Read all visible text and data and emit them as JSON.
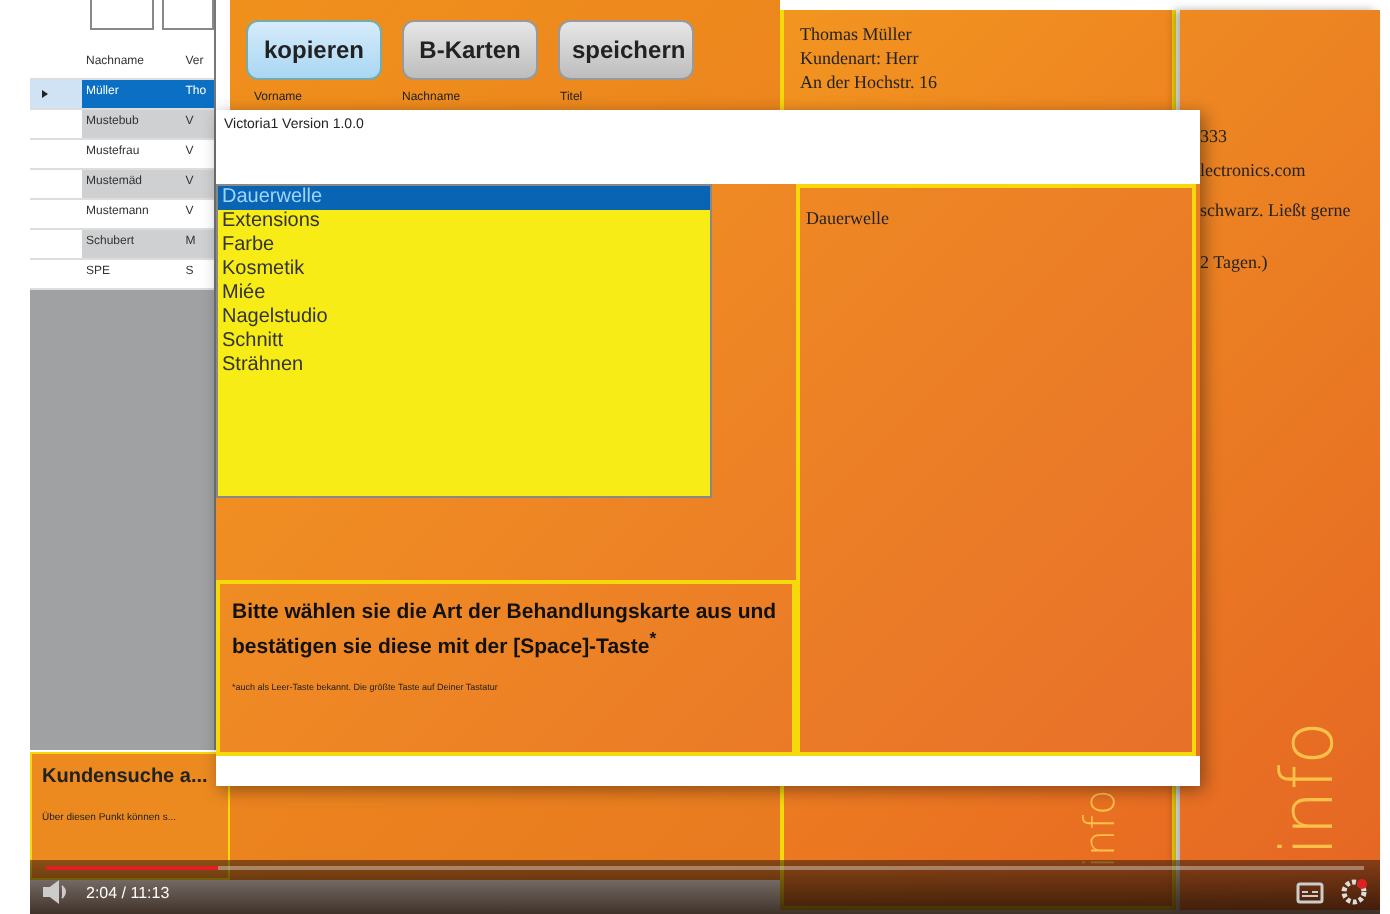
{
  "grid": {
    "columns": [
      "Nachname",
      "Ver"
    ],
    "rows": [
      {
        "cells": [
          "Müller",
          "Tho"
        ],
        "selected": true
      },
      {
        "cells": [
          "Mustebub",
          "V"
        ],
        "selected": false
      },
      {
        "cells": [
          "Mustefrau",
          "V"
        ],
        "selected": false
      },
      {
        "cells": [
          "Mustemäd",
          "V"
        ],
        "selected": false
      },
      {
        "cells": [
          "Mustemann",
          "V"
        ],
        "selected": false
      },
      {
        "cells": [
          "Schubert",
          "M"
        ],
        "selected": false
      },
      {
        "cells": [
          "SPE",
          "S"
        ],
        "selected": false
      }
    ]
  },
  "toolbar": {
    "buttons": [
      {
        "label": "kopieren",
        "selected": true
      },
      {
        "label": "B-Karten",
        "selected": false
      },
      {
        "label": "speichern",
        "selected": false
      }
    ]
  },
  "form_labels": [
    "Vorname",
    "Nachname",
    "Titel"
  ],
  "customer_card": {
    "lines": [
      "Thomas Müller",
      "Kundenart: Herr",
      "An der Hochstr. 16"
    ]
  },
  "details_fragments": [
    "333",
    "lectronics.com",
    "schwarz. Ließt gerne",
    "2 Tagen.)"
  ],
  "side_marks": [
    "info",
    "info"
  ],
  "search_panel": {
    "title": "Kundensuche a...",
    "text": "Über diesen Punkt können s..."
  },
  "dialog": {
    "title": "Victoria1 Version 1.0.0",
    "options": [
      {
        "label": "Dauerwelle",
        "selected": true
      },
      {
        "label": "Extensions",
        "selected": false
      },
      {
        "label": "Farbe",
        "selected": false
      },
      {
        "label": "Kosmetik",
        "selected": false
      },
      {
        "label": "Miée",
        "selected": false
      },
      {
        "label": "Nagelstudio",
        "selected": false
      },
      {
        "label": "Schnitt",
        "selected": false
      },
      {
        "label": "Strähnen",
        "selected": false
      }
    ],
    "preview": "Dauerwelle",
    "instruction": "Bitte wählen sie die Art der Behandlungskarte aus und bestätigen sie diese mit der [Space]-Taste$^{*}$",
    "footnote": "*auch als Leer-Taste bekannt. Die größte Taste auf Deiner Tastatur"
  },
  "player": {
    "time": "2:04 / 11:13",
    "progress": {
      "level": 0.13
    }
  }
}
